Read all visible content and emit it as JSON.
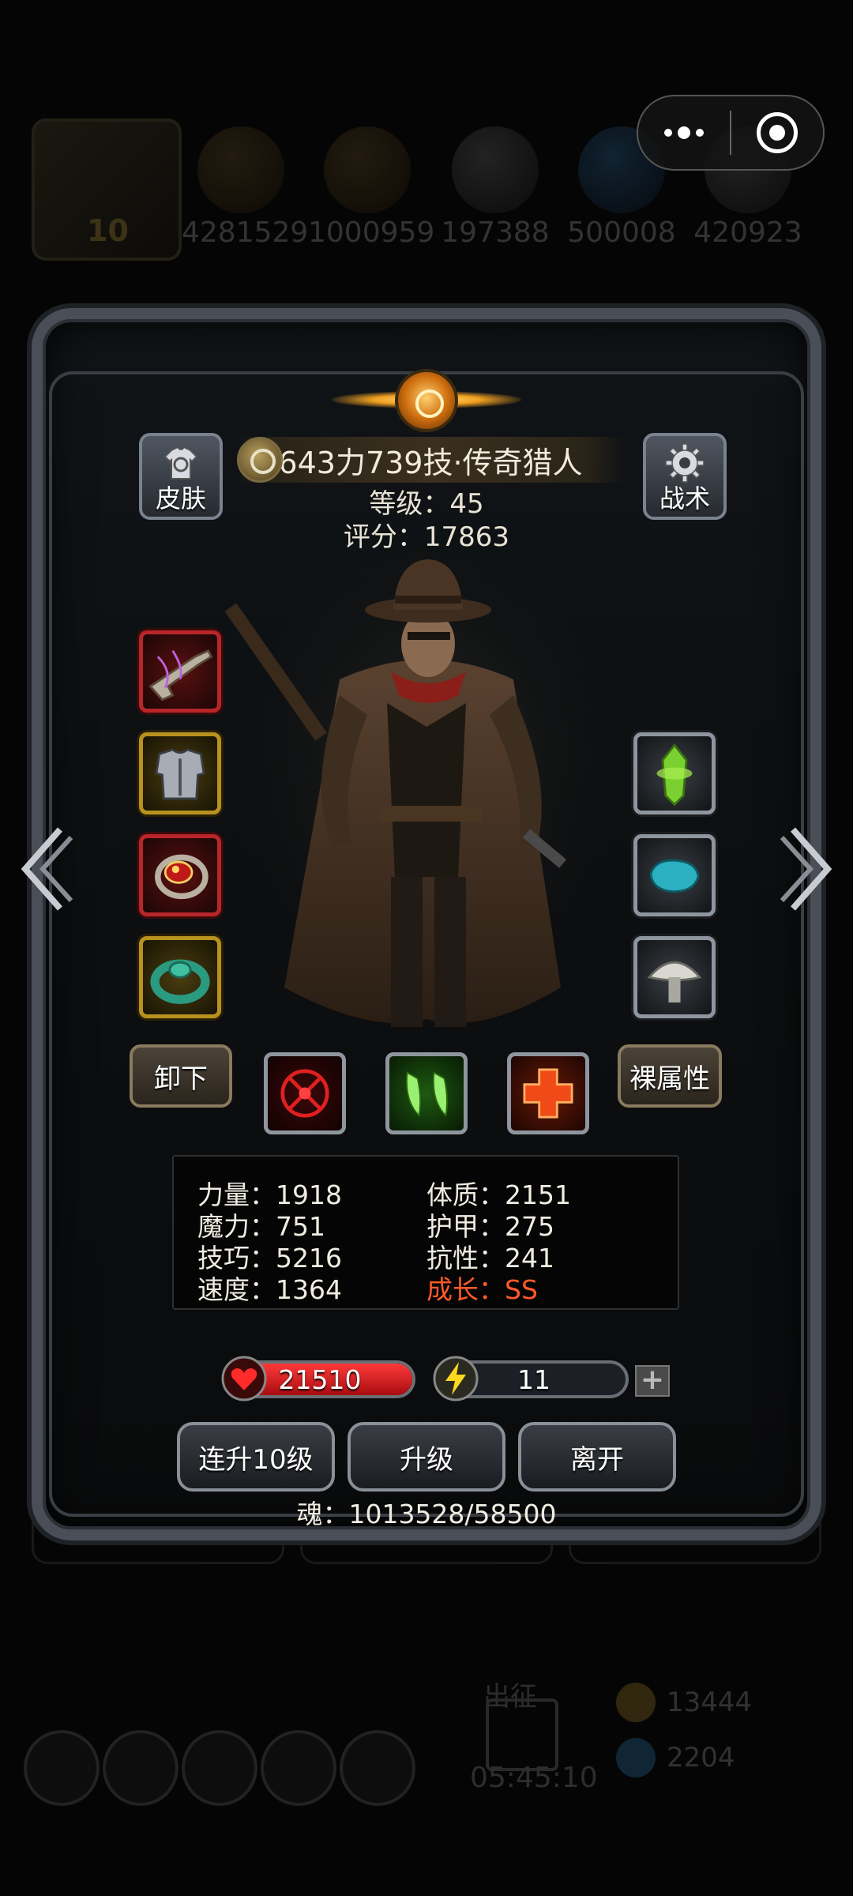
{
  "background": {
    "player_level": "10",
    "resources": [
      "4281529",
      "1000959",
      "197388",
      "500008",
      "420923"
    ],
    "coins": [
      "13444",
      "2204"
    ],
    "sortie_label": "出征",
    "timer": "05:45:10"
  },
  "header": {
    "name": "643力739技·传奇猎人",
    "level_text": "等级：45",
    "score_text": "评分：17863"
  },
  "buttons": {
    "skin": "皮肤",
    "tactics": "战术",
    "unequip": "卸下",
    "base_stats": "裸属性",
    "level_up_10": "连升10级",
    "level_up": "升级",
    "leave": "离开"
  },
  "equipment": {
    "left": [
      "flintlock-pistol",
      "silver-armor",
      "red-gem-ring",
      "jade-bracelet"
    ],
    "right": [
      "green-crystal",
      "blue-stone",
      "white-mushroom"
    ]
  },
  "skills": [
    "crosshair-skill",
    "claw-skill",
    "red-cross-skill"
  ],
  "stats": {
    "strength": "力量：1918",
    "magic": "魔力：751",
    "skill": "技巧：5216",
    "speed": "速度：1364",
    "constitution": "体质：2151",
    "armor": "护甲：275",
    "resistance": "抗性：241",
    "growth": "成长：SS"
  },
  "bars": {
    "hp": "21510",
    "energy": "11",
    "hp_fill": 1.0,
    "energy_fill": 0.12
  },
  "soul_text": "魂：1013528/58500",
  "colors": {
    "growth": "#ff5a28",
    "hp": "#d8141c",
    "energy": "#e8c820"
  }
}
